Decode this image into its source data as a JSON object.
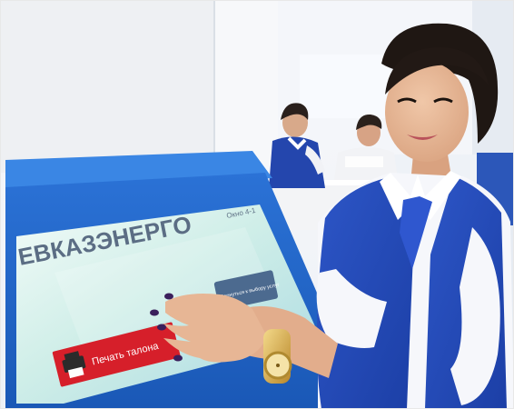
{
  "photo": {
    "kiosk_screen": {
      "brand_text": "ЕВКАЗЭНЕРГО",
      "top_right_text": "Окно 4-1",
      "back_button_text": "Вернуться к выбору услуг",
      "print_button_text": "Печать талона"
    }
  },
  "colors": {
    "kiosk_frame": "#1f63c4",
    "screen_bg": "#cfeee8",
    "print_button": "#d61f2a",
    "back_button": "#4c6a8f",
    "uniform_vest": "#2247b0",
    "shirt": "#f6f7fb",
    "skin": "#e7b695"
  }
}
